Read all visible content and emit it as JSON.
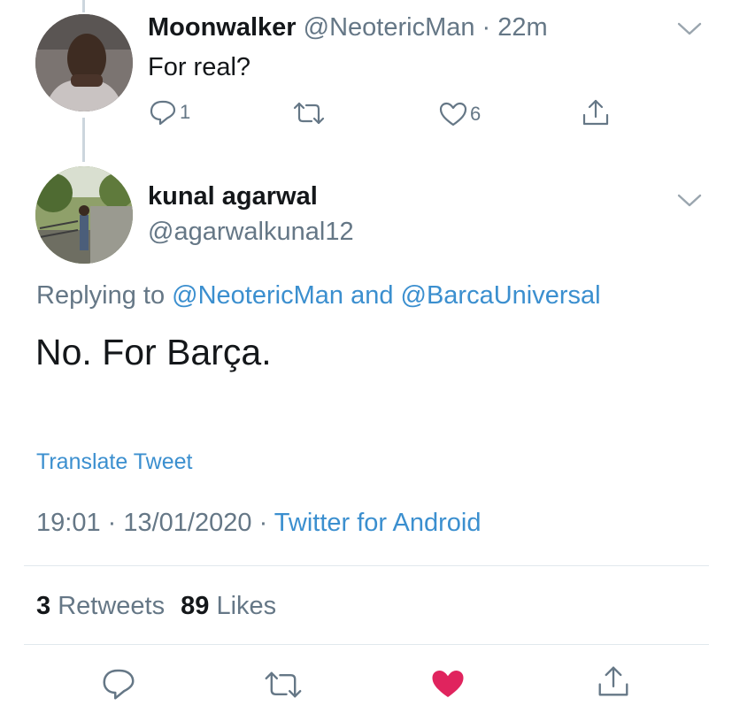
{
  "reply_tweet": {
    "name": "Moonwalker",
    "handle": "@NeotericMan",
    "sep": " · ",
    "time": "22m",
    "text": "For real?",
    "reply_count": "1",
    "like_count": "6"
  },
  "main_tweet": {
    "name": "kunal agarwal",
    "handle": "@agarwalkunal12",
    "replying_prefix": "Replying to",
    "replying_user1": "@NeotericMan",
    "replying_and": "and",
    "replying_user2": "@BarcaUniversal",
    "text": "No. For Barça.",
    "translate": "Translate Tweet",
    "time": "19:01",
    "dot": " · ",
    "date": "13/01/2020",
    "client": "Twitter for Android",
    "retweets_count": "3",
    "retweets_label": "Retweets",
    "likes_count": "89",
    "likes_label": "Likes"
  },
  "colors": {
    "link_blue": "#3b8fcf",
    "muted_gray": "#657786",
    "like_red": "#e0245e"
  }
}
